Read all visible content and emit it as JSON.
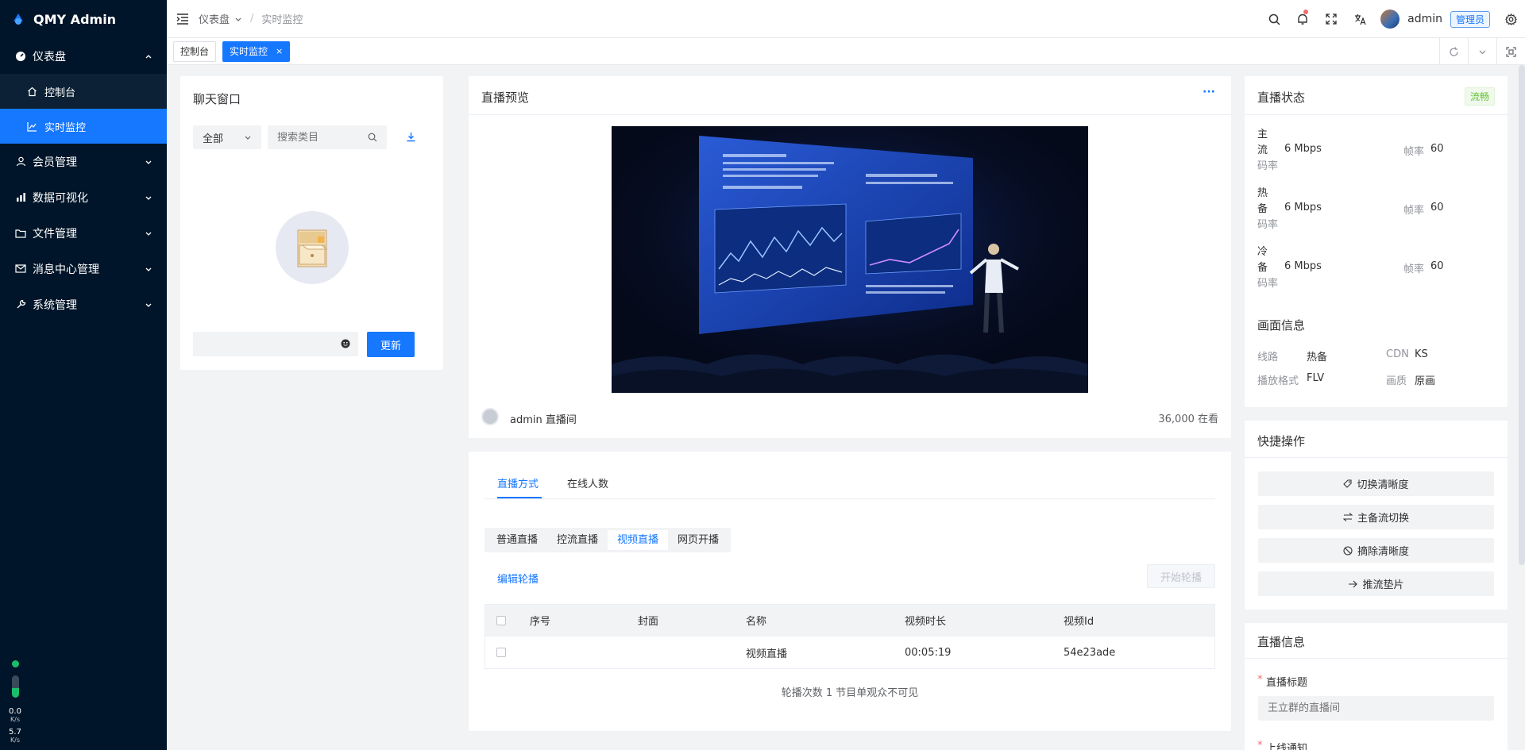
{
  "app": {
    "name": "QMY Admin",
    "brand_color": "#1677ff",
    "sidebar_bg": "#001529"
  },
  "sidebar": {
    "items": [
      {
        "label": "仪表盘",
        "icon": "dashboard-icon",
        "expanded": true,
        "children": [
          {
            "label": "控制台",
            "icon": "home-icon"
          },
          {
            "label": "实时监控",
            "icon": "line-chart-icon",
            "active": true
          }
        ]
      },
      {
        "label": "会员管理",
        "icon": "user-icon"
      },
      {
        "label": "数据可视化",
        "icon": "bar-chart-icon"
      },
      {
        "label": "文件管理",
        "icon": "folder-icon"
      },
      {
        "label": "消息中心管理",
        "icon": "mail-icon"
      },
      {
        "label": "系统管理",
        "icon": "wrench-icon"
      }
    ],
    "net": {
      "up_value": "0.0",
      "up_unit": "K/s",
      "down_value": "5.7",
      "down_unit": "K/s"
    }
  },
  "header": {
    "breadcrumb": [
      "仪表盘",
      "实时监控"
    ],
    "username": "admin",
    "role": "管理员",
    "icons": [
      "search-icon",
      "bell-icon",
      "fullscreen-icon",
      "translate-icon",
      "settings-icon"
    ]
  },
  "tabs": [
    {
      "label": "控制台",
      "active": false
    },
    {
      "label": "实时监控",
      "active": true,
      "close": "×"
    }
  ],
  "chat": {
    "title": "聊天窗口",
    "filter_value": "全部",
    "search_placeholder": "搜索类目",
    "input_value": "",
    "update_button": "更新"
  },
  "live": {
    "title": "直播预览",
    "more": "···",
    "room_name": "admin 直播间",
    "viewers": "36,000 在看"
  },
  "lower": {
    "tabs": [
      {
        "label": "直播方式",
        "active": true
      },
      {
        "label": "在线人数",
        "active": false
      }
    ],
    "modes": [
      {
        "label": "普通直播",
        "active": false
      },
      {
        "label": "控流直播",
        "active": false
      },
      {
        "label": "视频直播",
        "active": true
      },
      {
        "label": "网页开播",
        "active": false
      }
    ],
    "edit_link": "编辑轮播",
    "start_button": "开始轮播",
    "table": {
      "columns": [
        "序号",
        "封面",
        "名称",
        "视频时长",
        "视频Id"
      ],
      "rows": [
        {
          "index": "",
          "cover": "",
          "name": "视频直播",
          "duration": "00:05:19",
          "id": "54e23ade"
        }
      ]
    },
    "footer": "轮播次数 1 节目单观众不可见"
  },
  "status": {
    "title": "直播状态",
    "badge": "流畅",
    "streams": [
      {
        "name_lines": [
          "主",
          "流",
          "码率"
        ],
        "bitrate": "6 Mbps",
        "fps_label": "帧率",
        "fps": "60"
      },
      {
        "name_lines": [
          "热",
          "备",
          "码率"
        ],
        "bitrate": "6 Mbps",
        "fps_label": "帧率",
        "fps": "60"
      },
      {
        "name_lines": [
          "冷",
          "备",
          "码率"
        ],
        "bitrate": "6 Mbps",
        "fps_label": "帧率",
        "fps": "60"
      }
    ],
    "picture_title": "画面信息",
    "picture": {
      "route_label": "线路",
      "route": "热备",
      "cdn_label": "CDN",
      "cdn": "KS",
      "format_label": "播放格式",
      "format": "FLV",
      "quality_label": "画质",
      "quality": "原画"
    }
  },
  "quick": {
    "title": "快捷操作",
    "actions": [
      {
        "label": "切换清晰度",
        "icon": "tag-icon"
      },
      {
        "label": "主备流切换",
        "icon": "swap-icon"
      },
      {
        "label": "摘除清晰度",
        "icon": "ban-icon"
      },
      {
        "label": "推流垫片",
        "icon": "arrow-right-icon"
      }
    ]
  },
  "info": {
    "title": "直播信息",
    "field1_label": "直播标题",
    "field1_placeholder": "王立群的直播间",
    "field2_label": "上线通知",
    "required_mark": "*"
  }
}
